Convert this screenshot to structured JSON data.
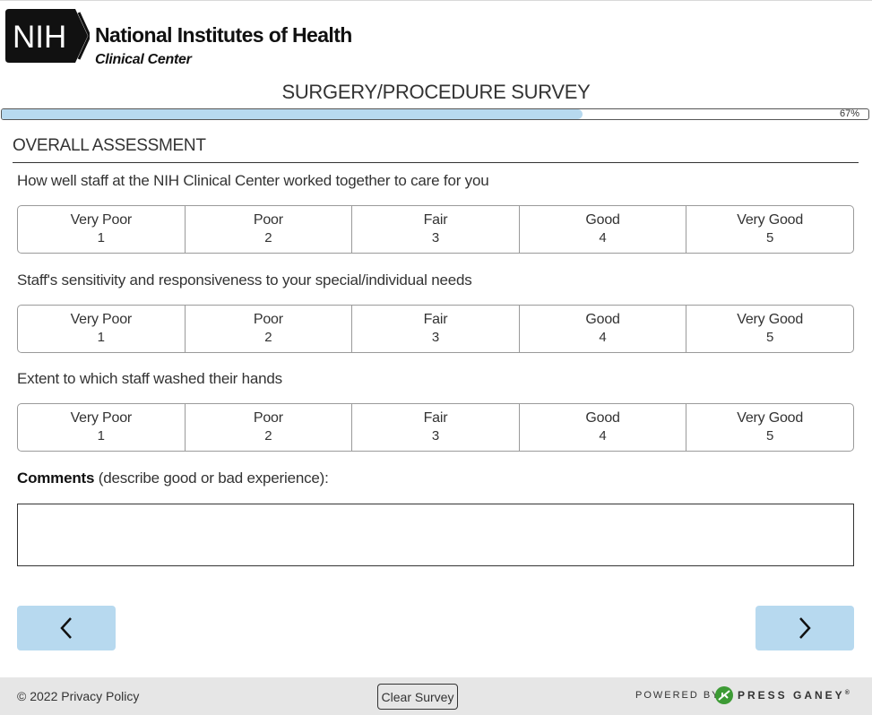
{
  "header": {
    "logo_mark": "NIH",
    "org_name": "National Institutes of Health",
    "org_sub": "Clinical Center"
  },
  "survey_title": "SURGERY/PROCEDURE SURVEY",
  "progress": {
    "percent": 67,
    "label": "67%"
  },
  "section": {
    "heading": "OVERALL ASSESSMENT"
  },
  "scale_options": [
    {
      "label": "Very Poor",
      "value": "1"
    },
    {
      "label": "Poor",
      "value": "2"
    },
    {
      "label": "Fair",
      "value": "3"
    },
    {
      "label": "Good",
      "value": "4"
    },
    {
      "label": "Very Good",
      "value": "5"
    }
  ],
  "questions": [
    {
      "text": "How well staff at the NIH Clinical Center worked together to care for you"
    },
    {
      "text": "Staff's sensitivity and responsiveness to your special/individual needs"
    },
    {
      "text": "Extent to which staff washed their hands"
    }
  ],
  "comments": {
    "label_bold": "Comments",
    "label_rest": " (describe good or bad experience):",
    "value": ""
  },
  "navigation": {
    "prev_icon": "chevron-left-icon",
    "next_icon": "chevron-right-icon"
  },
  "footer": {
    "copyright": "© 2022 Privacy Policy",
    "clear_button": "Clear Survey",
    "powered_by": "POWERED BY",
    "brand": "PRESS GANEY",
    "brand_mark": "®"
  },
  "colors": {
    "accent": "#b7d9ef",
    "footer_bg": "#e6e6e6",
    "brand_green": "#3d9b35"
  }
}
